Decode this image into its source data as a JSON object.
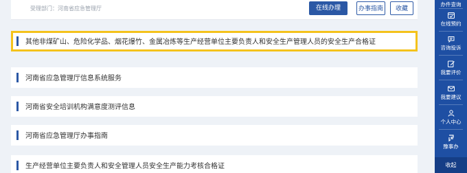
{
  "service_card": {
    "department": "受理部门：河南省应急管理厅",
    "online_button": "在线办理",
    "guide_button": "办事指南",
    "favorite_button": "收藏"
  },
  "items": [
    {
      "label": "其他非煤矿山、危险化学品、烟花爆竹、金属冶炼等生产经营单位主要负责人和安全生产管理人员的安全生产合格证"
    },
    {
      "label": "河南省应急管理厅信息系统服务"
    },
    {
      "label": "河南省安全培训机构满意度测评信息"
    },
    {
      "label": "河南省应急管理厅办事指南"
    },
    {
      "label": "生产经营单位主要负责人和安全管理人员安全生产能力考核合格证"
    }
  ],
  "sidebar": {
    "items": [
      {
        "label": "办件查询",
        "icon": "search-doc-icon"
      },
      {
        "label": "在线预约",
        "icon": "calendar-check-icon"
      },
      {
        "label": "咨询投诉",
        "icon": "chat-icon"
      },
      {
        "label": "我要评价",
        "icon": "edit-icon"
      },
      {
        "label": "我要建议",
        "icon": "mail-icon"
      },
      {
        "label": "个人中心",
        "icon": "user-icon"
      },
      {
        "label": "豫事办",
        "icon": "app-logo-icon"
      }
    ],
    "collapse_label": "收起"
  },
  "colors": {
    "primary": "#2b58a5",
    "sidebar": "#1e4fa3",
    "highlight": "#f4c21b"
  }
}
